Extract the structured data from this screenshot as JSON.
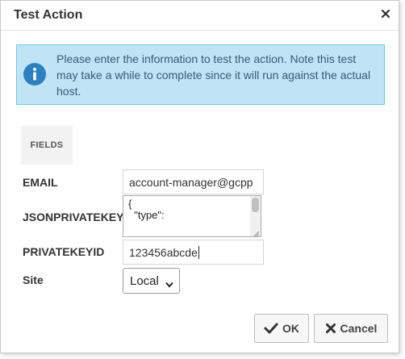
{
  "dialog": {
    "title": "Test Action"
  },
  "alert": {
    "message": "Please enter the information to test the action. Note this test may take a while to complete since it will run against the actual host.",
    "icon": "info-icon"
  },
  "tab": {
    "label": "FIELDS"
  },
  "fields": {
    "email": {
      "label": "EMAIL",
      "value": "account-manager@gcpp"
    },
    "jsonprivatekey": {
      "label": "JSONPRIVATEKEY",
      "value": "{\n  \"type\":"
    },
    "privatekeyid": {
      "label": "PRIVATEKEYID",
      "value": "123456abcde"
    },
    "site": {
      "label": "Site",
      "value": "Local"
    }
  },
  "buttons": {
    "ok": "OK",
    "cancel": "Cancel"
  },
  "colors": {
    "alert_bg": "#bfe4f6",
    "alert_border": "#7cc3e6",
    "info_icon": "#2f7fbf",
    "ok_check": "#333333",
    "cancel_x": "#333333"
  }
}
